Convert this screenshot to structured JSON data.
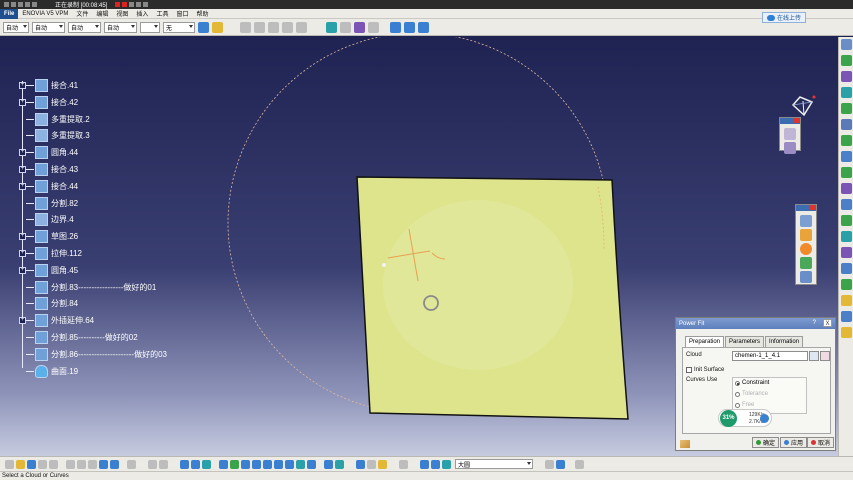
{
  "titlebar": {
    "recording_label": "正在录制 [00:08:45]"
  },
  "menubar": {
    "file_label": "File",
    "items": [
      "ENOVIA V5 VPM",
      "文件",
      "编辑",
      "视图",
      "插入",
      "工具",
      "窗口",
      "帮助"
    ]
  },
  "toolbar": {
    "combos": [
      "自动",
      "自动",
      "自动",
      "自动",
      "无"
    ],
    "online_label": "在线上传"
  },
  "tree": {
    "items": [
      {
        "label": "接合.41",
        "icon": "join-icon",
        "expandable": true
      },
      {
        "label": "接合.42",
        "icon": "join-icon",
        "expandable": true
      },
      {
        "label": "多重提取.2",
        "icon": "multi-extract-icon",
        "expandable": false
      },
      {
        "label": "多重提取.3",
        "icon": "multi-extract-icon",
        "expandable": false
      },
      {
        "label": "圆角.44",
        "icon": "fillet-icon",
        "expandable": true
      },
      {
        "label": "接合.43",
        "icon": "join-icon",
        "expandable": true
      },
      {
        "label": "接合.44",
        "icon": "join-icon",
        "expandable": true
      },
      {
        "label": "分割.82",
        "icon": "split-icon",
        "expandable": false
      },
      {
        "label": "边界.4",
        "icon": "boundary-icon",
        "expandable": false
      },
      {
        "label": "草图.26",
        "icon": "sketch-icon",
        "expandable": true
      },
      {
        "label": "拉伸.112",
        "icon": "extrude-icon",
        "expandable": true
      },
      {
        "label": "圆角.45",
        "icon": "fillet-icon",
        "expandable": true
      },
      {
        "label": "分割.83-----------------做好的01",
        "icon": "split-icon",
        "expandable": false
      },
      {
        "label": "分割.84",
        "icon": "split-icon",
        "expandable": false
      },
      {
        "label": "外插延伸.64",
        "icon": "extrapolate-icon",
        "expandable": true
      },
      {
        "label": "分割.85----------做好的02",
        "icon": "split-icon",
        "expandable": false
      },
      {
        "label": "分割.86---------------------做好的03",
        "icon": "split-icon",
        "expandable": false
      },
      {
        "label": "曲面.19",
        "icon": "cloud-surface-icon",
        "expandable": false
      }
    ]
  },
  "dialog": {
    "title": "Power Fit",
    "help": "?",
    "close": "X",
    "tabs": [
      "Preparation",
      "Parameters",
      "Information"
    ],
    "active_tab": "Preparation",
    "cloud_label": "Cloud",
    "cloud_value": "chemen-1_1_4.1",
    "init_surface_label": "Init Surface",
    "init_surface_checked": false,
    "curves_use_label": "Curves Use",
    "curves_options": [
      "Constraint",
      "Tolerance",
      "Free"
    ],
    "curves_selected": "Constraint",
    "gauge_percent": "31%",
    "gauge_up": "129K/s",
    "gauge_down": "2.7K/s",
    "buttons": {
      "ok": "确定",
      "apply": "应用",
      "cancel": "取消"
    }
  },
  "bottom": {
    "combo_value": "大圆"
  },
  "status": {
    "message": "Select a Cloud or Curves"
  },
  "colors": {
    "viewport_top": "#1f2352",
    "viewport_bottom": "#c7cbe0",
    "surface_fill": "#dde48c",
    "curve": "#e8a050",
    "title_blue": "#5d7fbd"
  }
}
